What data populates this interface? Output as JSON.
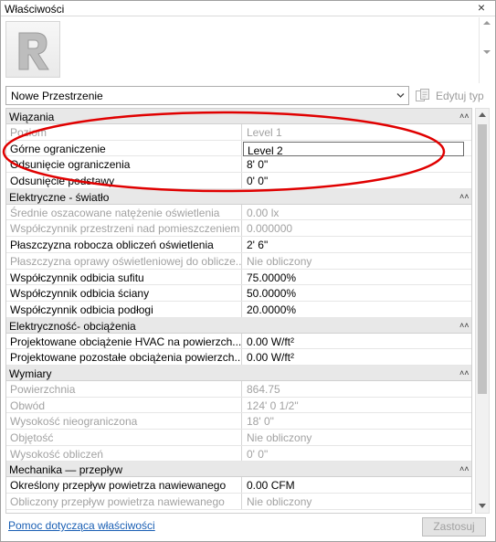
{
  "window": {
    "title": "Właściwości"
  },
  "type_selector": {
    "selected": "Nowe Przestrzenie",
    "edit_type_label": "Edytuj typ"
  },
  "groups": [
    {
      "label": "Wiązania",
      "rows": [
        {
          "name": "Poziom",
          "value": "Level 1",
          "dim": true
        },
        {
          "name": "Górne ograniczenie",
          "value": "Level 2",
          "dim": false,
          "editing": true
        },
        {
          "name": "Odsunięcie ograniczenia",
          "value": "8'  0\"",
          "dim": false
        },
        {
          "name": "Odsunięcie podstawy",
          "value": "0'  0\"",
          "dim": false
        }
      ]
    },
    {
      "label": "Elektryczne - światło",
      "rows": [
        {
          "name": "Średnie oszacowane natężenie oświetlenia",
          "value": "0.00 lx",
          "dim": true
        },
        {
          "name": "Współczynnik przestrzeni nad pomieszczeniem",
          "value": "0.000000",
          "dim": true
        },
        {
          "name": "Płaszczyzna robocza obliczeń oświetlenia",
          "value": "2'  6\"",
          "dim": false
        },
        {
          "name": "Płaszczyzna oprawy oświetleniowej do oblicze...",
          "value": "Nie obliczony",
          "dim": true
        },
        {
          "name": "Współczynnik odbicia sufitu",
          "value": "75.0000%",
          "dim": false
        },
        {
          "name": "Współczynnik odbicia ściany",
          "value": "50.0000%",
          "dim": false
        },
        {
          "name": "Współczynnik odbicia podłogi",
          "value": "20.0000%",
          "dim": false
        }
      ]
    },
    {
      "label": "Elektryczność- obciążenia",
      "rows": [
        {
          "name": "Projektowane obciążenie HVAC na powierzch...",
          "value": "0.00 W/ft²",
          "dim": false
        },
        {
          "name": "Projektowane pozostałe obciążenia powierzch...",
          "value": "0.00 W/ft²",
          "dim": false
        }
      ]
    },
    {
      "label": "Wymiary",
      "rows": [
        {
          "name": "Powierzchnia",
          "value": "864.75",
          "dim": true
        },
        {
          "name": "Obwód",
          "value": "124'  0 1/2\"",
          "dim": true
        },
        {
          "name": "Wysokość nieograniczona",
          "value": "18'  0\"",
          "dim": true
        },
        {
          "name": "Objętość",
          "value": "Nie obliczony",
          "dim": true
        },
        {
          "name": "Wysokość obliczeń",
          "value": "0'  0\"",
          "dim": true
        }
      ]
    },
    {
      "label": "Mechanika — przepływ",
      "rows": [
        {
          "name": "Określony przepływ powietrza nawiewanego",
          "value": "0.00 CFM",
          "dim": false
        },
        {
          "name": "Obliczony przepływ powietrza nawiewanego",
          "value": "Nie obliczony",
          "dim": true
        }
      ]
    }
  ],
  "footer": {
    "help_link": "Pomoc dotycząca właściwości",
    "apply_label": "Zastosuj"
  },
  "colors": {
    "highlight": "#e00000",
    "group_header_bg": "#e8e8e8",
    "disabled_text": "#a2a2a2",
    "link": "#1a5fb4"
  },
  "icons": {
    "close": "close-icon",
    "logo": "revit-logo",
    "dropdown": "chevron-down-icon",
    "edit_type": "edit-type-icon",
    "collapse": "collapse-icon"
  }
}
